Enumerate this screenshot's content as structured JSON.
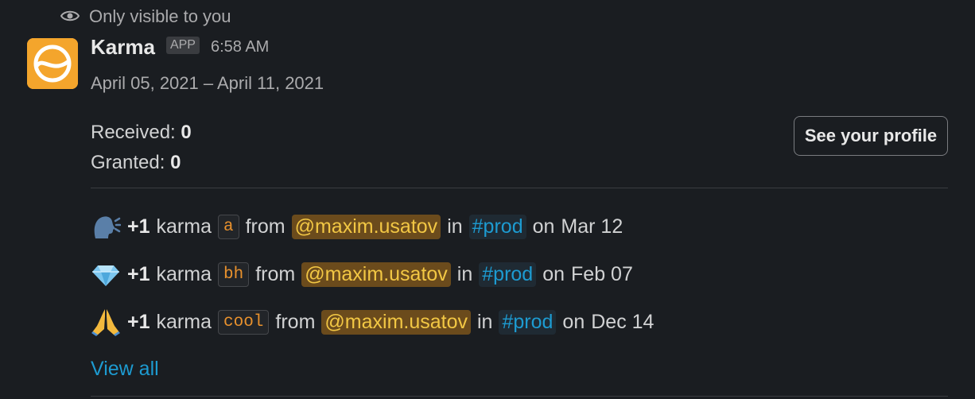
{
  "visibility": {
    "icon": "eye-icon",
    "text": "Only visible to you"
  },
  "message": {
    "app_name": "Karma",
    "badge": "APP",
    "time": "6:58 AM",
    "date_range": "April 05, 2021 – April 11, 2021",
    "received_label": "Received:",
    "received_value": "0",
    "granted_label": "Granted:",
    "granted_value": "0",
    "profile_button": "See your profile",
    "view_all": "View all"
  },
  "karma_entries": [
    {
      "icon": "speaking-head-emoji",
      "plus": "+1",
      "karma": "karma",
      "tag": "a",
      "from": "from",
      "user": "@maxim.usatov",
      "in": "in",
      "channel": "#prod",
      "on": "on",
      "date": "Mar 12"
    },
    {
      "icon": "gem-emoji",
      "plus": "+1",
      "karma": "karma",
      "tag": "bh",
      "from": "from",
      "user": "@maxim.usatov",
      "in": "in",
      "channel": "#prod",
      "on": "on",
      "date": "Feb 07"
    },
    {
      "icon": "folded-hands-emoji",
      "plus": "+1",
      "karma": "karma",
      "tag": "cool",
      "from": "from",
      "user": "@maxim.usatov",
      "in": "in",
      "channel": "#prod",
      "on": "on",
      "date": "Dec 14"
    }
  ],
  "colors": {
    "background": "#1a1d21",
    "avatar": "#f4a52c",
    "link": "#1d9bd1",
    "mention_bg": "#6b4b1c",
    "mention_text": "#f2c744",
    "code_text": "#e8912d"
  }
}
